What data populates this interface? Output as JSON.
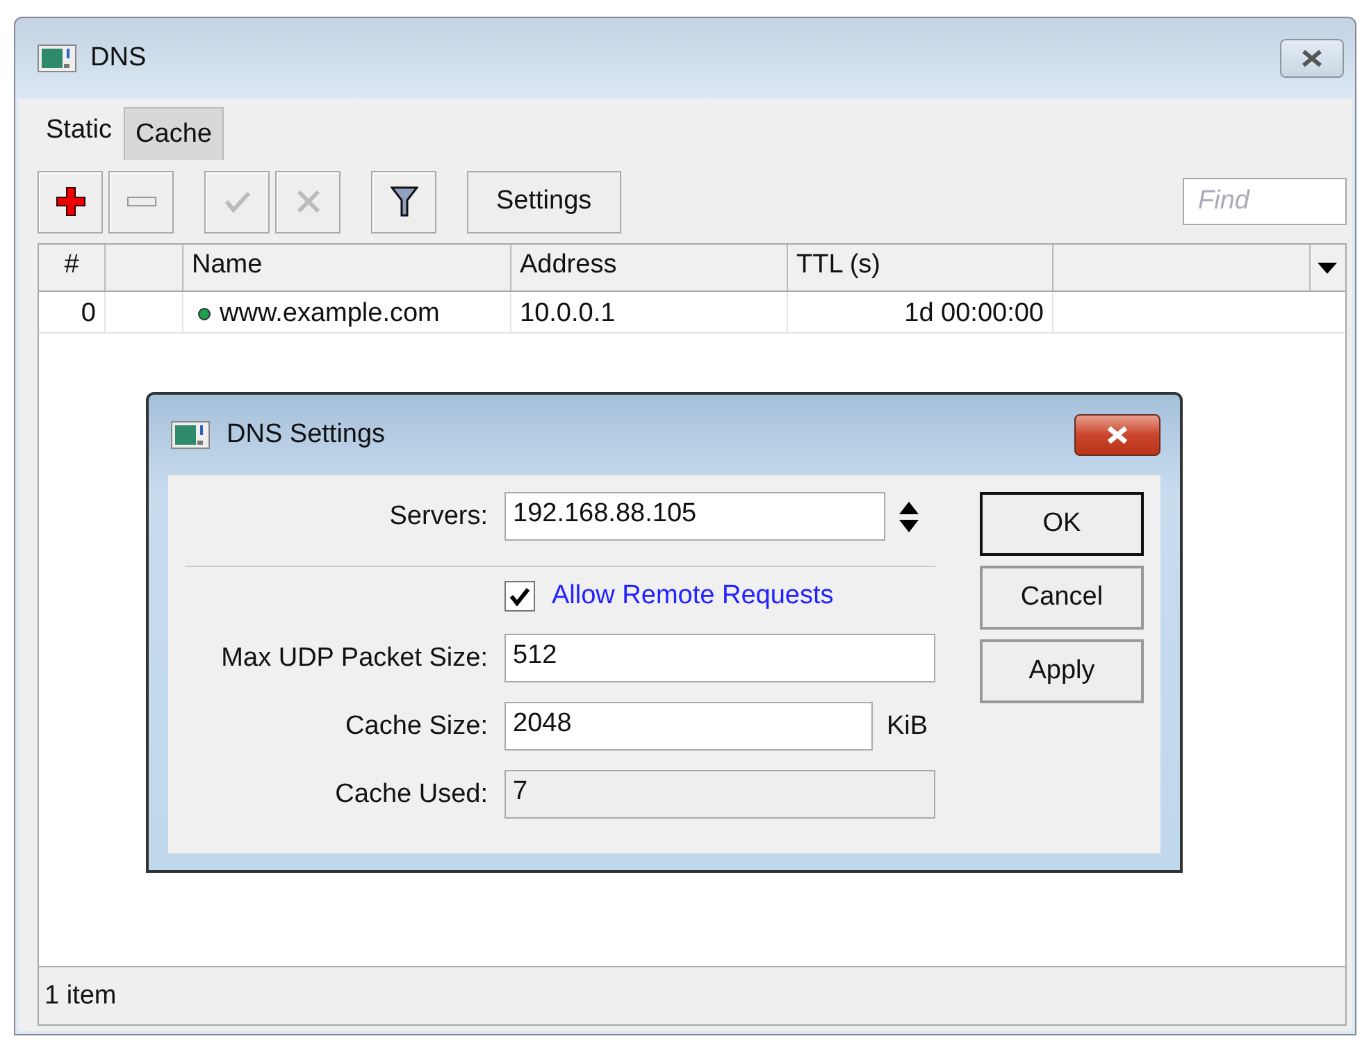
{
  "window": {
    "title": "DNS"
  },
  "tabs": [
    {
      "label": "Static",
      "selected": true
    },
    {
      "label": "Cache",
      "selected": false
    }
  ],
  "toolbar": {
    "settings_button": "Settings",
    "find": {
      "placeholder": "Find"
    }
  },
  "table": {
    "columns": [
      "#",
      "",
      "Name",
      "Address",
      "TTL (s)",
      ""
    ],
    "rows": [
      {
        "index": "0",
        "name": "www.example.com",
        "address": "10.0.0.1",
        "ttl": "1d 00:00:00",
        "color": "#1aa04a"
      }
    ]
  },
  "status_bar": "1 item",
  "dialog": {
    "title": "DNS Settings",
    "servers": {
      "label": "Servers:",
      "value": "192.168.88.105"
    },
    "allow_remote": {
      "label": "Allow Remote Requests",
      "checked": true
    },
    "max_udp": {
      "label": "Max UDP Packet Size:",
      "value": "512"
    },
    "cache_size": {
      "label": "Cache Size:",
      "value": "2048",
      "unit": "KiB"
    },
    "cache_used": {
      "label": "Cache Used:",
      "value": "7",
      "disabled": true
    },
    "buttons": [
      "OK",
      "Cancel",
      "Apply"
    ]
  }
}
